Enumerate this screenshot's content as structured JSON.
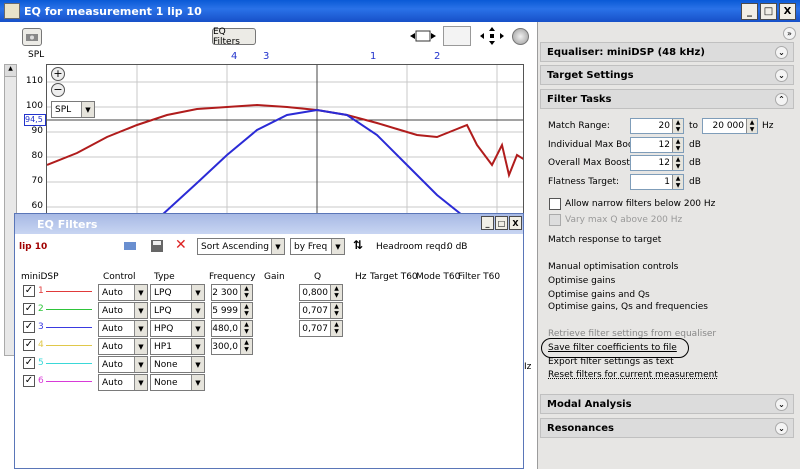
{
  "window": {
    "title": "EQ for measurement 1 lip 10",
    "minimize": "_",
    "maximize": "□",
    "close": "X"
  },
  "toolbar": {
    "eq_filters_label": "EQ Filters"
  },
  "graph": {
    "spl_label": "SPL",
    "y_ticks": [
      "110",
      "100",
      "90",
      "80",
      "70",
      "60"
    ],
    "cursor_value": "94,5",
    "markers": [
      "4",
      "3",
      "1",
      "2"
    ],
    "spl_select": "SPL",
    "colors": {
      "measured": "#b01c1c",
      "target": "#2b2bd6"
    }
  },
  "eq_dialog": {
    "title": "EQ Filters",
    "measurement": "lip 10",
    "sort_select": "Sort Ascending",
    "by_select": "by Freq",
    "headroom_label": "Headroom reqd:",
    "headroom_value": "0 dB",
    "columns": [
      "miniDSP",
      "Control",
      "Type",
      "Frequency",
      "Gain",
      "Q",
      "Hz",
      "Target T60",
      "Mode T60",
      "Filter T60"
    ],
    "rows": [
      {
        "num": "1",
        "color": "#e03a3a",
        "checked": true,
        "control": "Auto",
        "type": "LPQ",
        "freq": "2 300",
        "q": "0,800"
      },
      {
        "num": "2",
        "color": "#2ec43a",
        "checked": true,
        "control": "Auto",
        "type": "LPQ",
        "freq": "5 999",
        "q": "0,707"
      },
      {
        "num": "3",
        "color": "#3a3ae0",
        "checked": true,
        "control": "Auto",
        "type": "HPQ",
        "freq": "480,0",
        "q": "0,707"
      },
      {
        "num": "4",
        "color": "#e0c84a",
        "checked": true,
        "control": "Auto",
        "type": "HP1",
        "freq": "300,0",
        "q": ""
      },
      {
        "num": "5",
        "color": "#3ad8d8",
        "checked": true,
        "control": "Auto",
        "type": "None",
        "freq": "",
        "q": ""
      },
      {
        "num": "6",
        "color": "#d83ad8",
        "checked": true,
        "control": "Auto",
        "type": "None",
        "freq": "",
        "q": ""
      }
    ],
    "minimize": "_",
    "maximize": "□",
    "close": "X"
  },
  "right_panel": {
    "equaliser_header": "Equaliser: miniDSP (48 kHz)",
    "target_header": "Target Settings",
    "filter_header": "Filter Tasks",
    "match_range_label": "Match Range:",
    "match_from": "20",
    "to_label": "to",
    "match_to": "20 000",
    "hz_label": "Hz",
    "max_boost_label": "Individual Max Boost:",
    "max_boost": "12",
    "overall_boost_label": "Overall Max Boost:",
    "overall_boost": "12",
    "flatness_label": "Flatness Target:",
    "flatness": "1",
    "db_label": "dB",
    "narrow_label": "Allow narrow filters below 200 Hz",
    "vary_q_label": "Vary max Q above 200 Hz",
    "match_response": "Match response to target",
    "manual_controls": "Manual optimisation controls",
    "optimise_gains": "Optimise gains",
    "optimise_gains_qs": "Optimise gains and Qs",
    "optimise_all": "Optimise gains, Qs and frequencies",
    "retrieve": "Retrieve filter settings from equaliser",
    "save_coeffs": "Save filter coefficients to file",
    "export": "Export filter settings as text",
    "reset": "Reset filters for current measurement",
    "modal_header": "Modal Analysis",
    "resonances_header": "Resonances",
    "side_hz": "Iz"
  }
}
